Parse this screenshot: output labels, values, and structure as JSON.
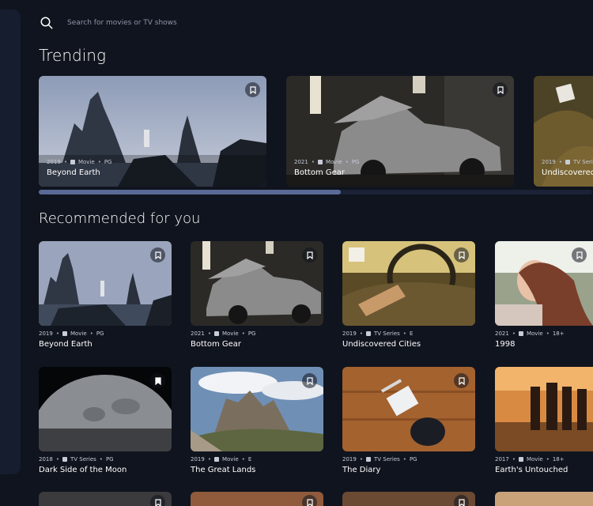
{
  "search": {
    "placeholder": "Search for movies or TV shows"
  },
  "sections": {
    "trending": "Trending",
    "recommended": "Recommended for you"
  },
  "trending": [
    {
      "year": "2019",
      "category": "Movie",
      "rating": "PG",
      "title": "Beyond Earth"
    },
    {
      "year": "2021",
      "category": "Movie",
      "rating": "PG",
      "title": "Bottom Gear"
    },
    {
      "year": "2019",
      "category": "TV Series",
      "rating": "",
      "title": "Undiscovered"
    }
  ],
  "recommended": [
    {
      "year": "2019",
      "category": "Movie",
      "rating": "PG",
      "title": "Beyond Earth"
    },
    {
      "year": "2021",
      "category": "Movie",
      "rating": "PG",
      "title": "Bottom Gear"
    },
    {
      "year": "2019",
      "category": "TV Series",
      "rating": "E",
      "title": "Undiscovered Cities"
    },
    {
      "year": "2021",
      "category": "Movie",
      "rating": "18+",
      "title": "1998"
    },
    {
      "year": "2018",
      "category": "TV Series",
      "rating": "PG",
      "title": "Dark Side of the Moon"
    },
    {
      "year": "2019",
      "category": "Movie",
      "rating": "E",
      "title": "The Great Lands"
    },
    {
      "year": "2019",
      "category": "TV Series",
      "rating": "PG",
      "title": "The Diary"
    },
    {
      "year": "2017",
      "category": "Movie",
      "rating": "18+",
      "title": "Earth's Untouched"
    }
  ],
  "colors": {
    "background": "#10141e",
    "sidebar": "#161d2f",
    "scrollbar_thumb": "#5a6a96",
    "placeholder": "#8e95a9"
  }
}
